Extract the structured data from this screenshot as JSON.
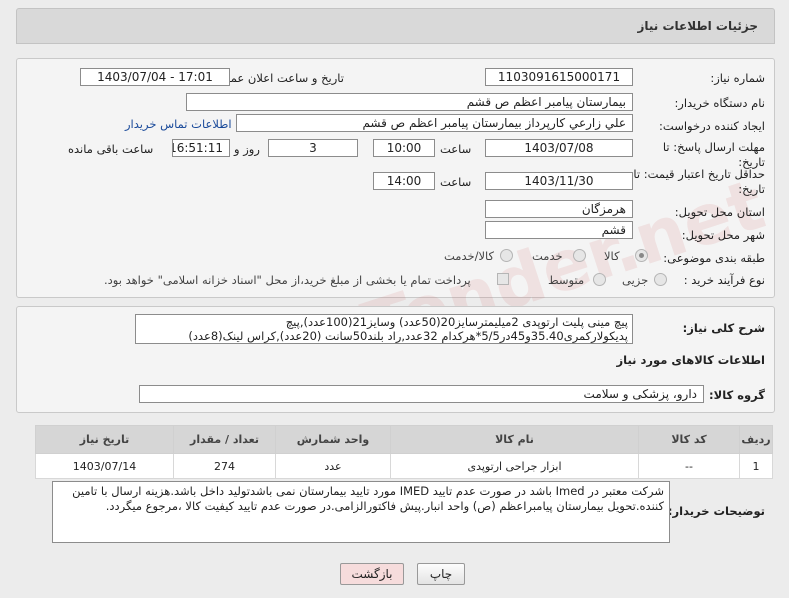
{
  "page_title": "جزئیات اطلاعات نیاز",
  "fields": {
    "need_number_label": "شماره نیاز:",
    "need_number": "1103091615000171",
    "announce_label": "تاریخ و ساعت اعلان عمومی:",
    "announce_value": "1403/07/04 - 17:01",
    "buyer_org_label": "نام دستگاه خریدار:",
    "buyer_org": "بیمارستان پیامبر اعظم  ص  قشم",
    "creator_label": "ایجاد کننده درخواست:",
    "creator": "علي زارعي کارپرداز بیمارستان پیامبر اعظم  ص  قشم",
    "contact_link": "اطلاعات تماس خریدار",
    "deadline_label_1": "مهلت ارسال پاسخ: تا",
    "deadline_label_2": "تاریخ:",
    "deadline_date": "1403/07/08",
    "time_label": "ساعت",
    "deadline_time": "10:00",
    "days_value": "3",
    "days_label": "روز و",
    "remaining_time": "16:51:11",
    "remaining_label": "ساعت باقی مانده",
    "validity_label_1": "حداقل تاریخ اعتبار قیمت: تا",
    "validity_label_2": "تاریخ:",
    "validity_date": "1403/11/30",
    "validity_time": "14:00",
    "province_label": "استان محل تحویل:",
    "province": "هرمزگان",
    "city_label": "شهر محل تحویل:",
    "city": "قشم",
    "category_label": "طبقه بندی موضوعی:",
    "category_options": [
      "کالا",
      "خدمت",
      "کالا/خدمت"
    ],
    "process_label": "نوع فرآیند خرید :",
    "process_options": [
      "جزیی",
      "متوسط"
    ],
    "treasury_note": "پرداخت تمام یا بخشی از مبلغ خرید،از محل \"اسناد خزانه اسلامی\" خواهد بود."
  },
  "summary": {
    "label": "شرح کلی نیاز:",
    "text": "پیچ مینی پلیت ارتوپدی 2میلیمترسایز20(50عدد) وسایز21(100عدد),پیچ پدیکولارکمری35.40و45در5/5*هرکدام 32عدد,راد بلند50سانت (20عدد),کراس لینک(8عدد)"
  },
  "goods_section": {
    "title": "اطلاعات کالاهای مورد نیاز",
    "group_label": "گروه کالا:",
    "group_value": "دارو، پزشکی و سلامت"
  },
  "table": {
    "headers": [
      "ردیف",
      "کد کالا",
      "نام کالا",
      "واحد شمارش",
      "تعداد / مقدار",
      "تاریخ نیاز"
    ],
    "rows": [
      [
        "1",
        "--",
        "ابزار جراحی ارتوپدی",
        "عدد",
        "274",
        "1403/07/14"
      ]
    ]
  },
  "buyer_notes": {
    "label": "توضیحات خریدار:",
    "text": "شرکت معتبر در Imed  باشد در صورت عدم تایید IMED مورد تایید بیمارستان نمی باشدتولید داخل باشد.هزینه ارسال با تامین کننده.تحویل  بیمارستان پیامبراعظم (ص) واحد انبار.پیش فاکتورالزامی.در صورت عدم تایید کیفیت کالا ،مرجوع میگردد."
  },
  "buttons": {
    "print": "چاپ",
    "back": "بازگشت"
  },
  "watermark_text": "AriaTender.net",
  "colors": {
    "back_button_bg": "#f6dcdc",
    "link": "#1a4a9a",
    "header_bg": "#d9d9d9"
  }
}
